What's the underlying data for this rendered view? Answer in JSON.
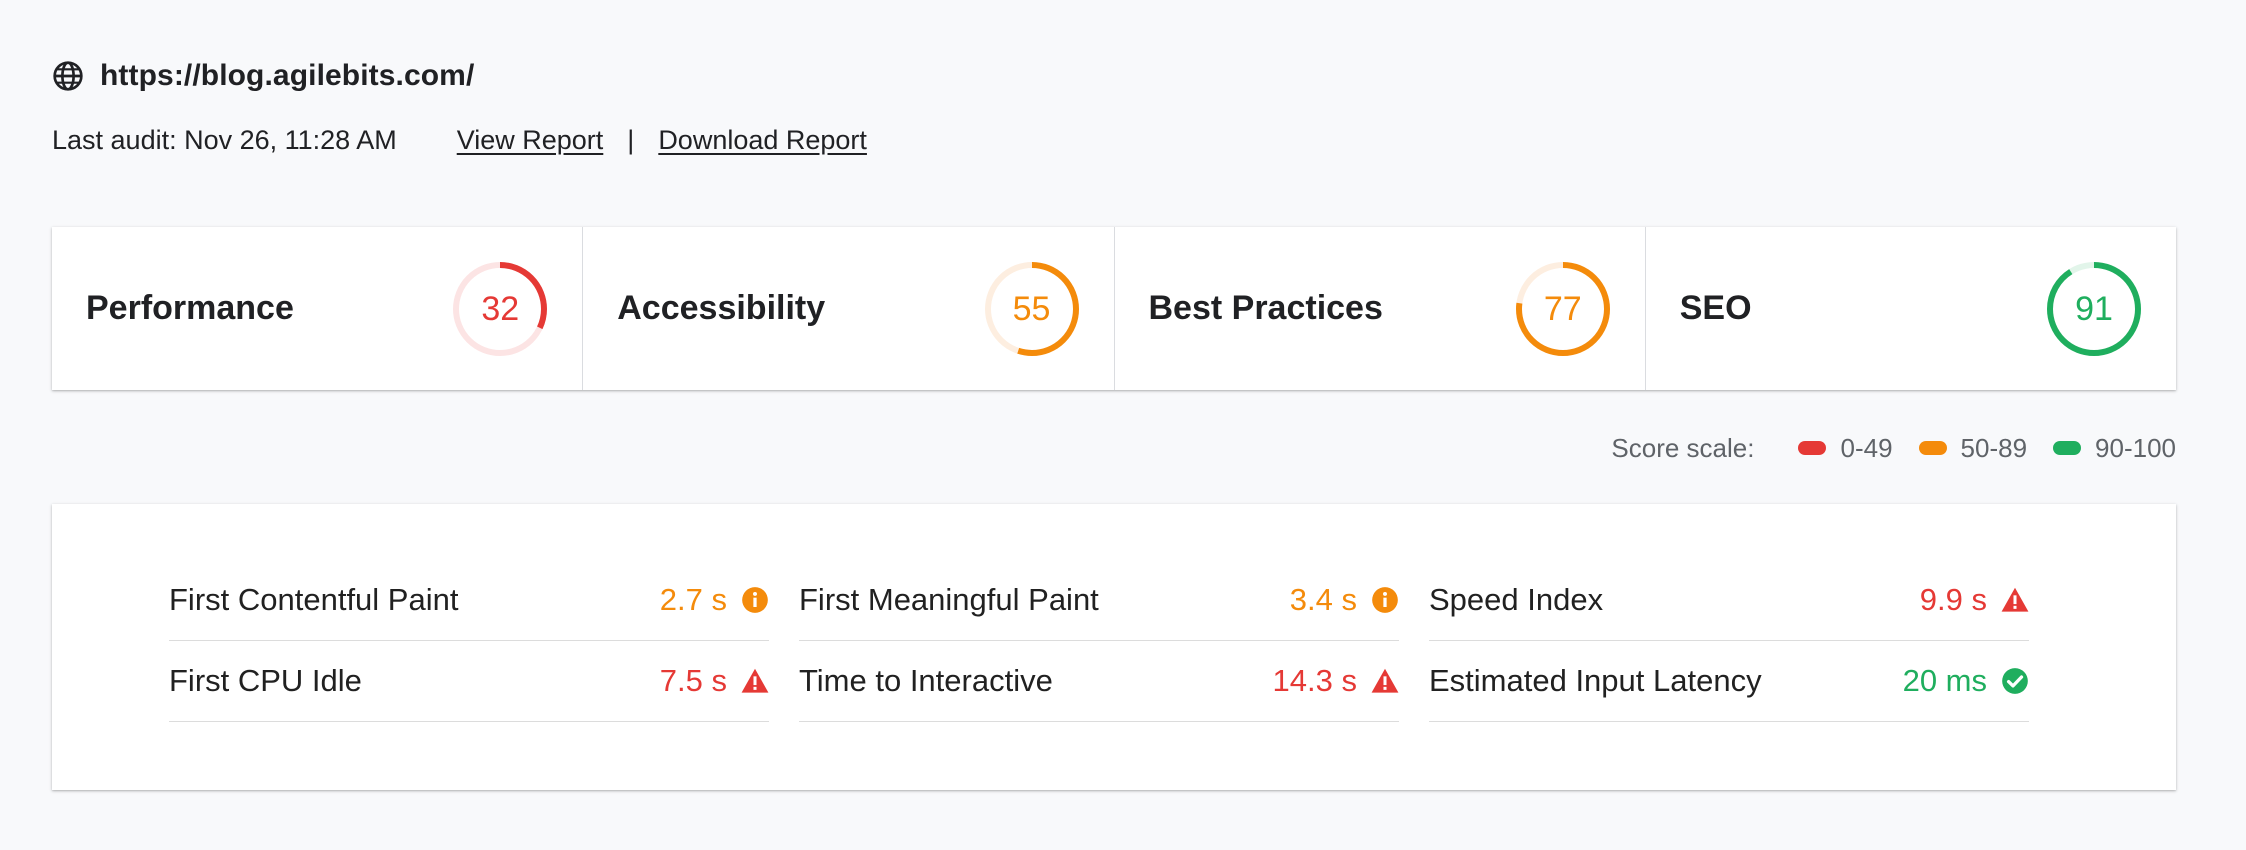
{
  "header": {
    "url": "https://blog.agilebits.com/",
    "last_audit": "Last audit: Nov 26, 11:28 AM",
    "view_report": "View Report",
    "separator": "|",
    "download_report": "Download Report"
  },
  "categories": [
    {
      "name": "Performance",
      "score": "32",
      "fraction": 0.32,
      "color": "#e53935",
      "track": "#fce4e4"
    },
    {
      "name": "Accessibility",
      "score": "55",
      "fraction": 0.55,
      "color": "#f48b0b",
      "track": "#fdeee0"
    },
    {
      "name": "Best Practices",
      "score": "77",
      "fraction": 0.77,
      "color": "#f48b0b",
      "track": "#fdeee0"
    },
    {
      "name": "SEO",
      "score": "91",
      "fraction": 0.91,
      "color": "#1fae5e",
      "track": "#e2f5ea"
    }
  ],
  "score_scale": {
    "label": "Score scale:",
    "ranges": [
      {
        "label": "0-49",
        "color": "#e53935"
      },
      {
        "label": "50-89",
        "color": "#f48b0b"
      },
      {
        "label": "90-100",
        "color": "#1fae5e"
      }
    ]
  },
  "metrics": [
    {
      "label": "First Contentful Paint",
      "value": "2.7 s",
      "status": "average",
      "icon": "info-icon"
    },
    {
      "label": "First Meaningful Paint",
      "value": "3.4 s",
      "status": "average",
      "icon": "info-icon"
    },
    {
      "label": "Speed Index",
      "value": "9.9 s",
      "status": "fail",
      "icon": "warning-icon"
    },
    {
      "label": "First CPU Idle",
      "value": "7.5 s",
      "status": "fail",
      "icon": "warning-icon"
    },
    {
      "label": "Time to Interactive",
      "value": "14.3 s",
      "status": "fail",
      "icon": "warning-icon"
    },
    {
      "label": "Estimated Input Latency",
      "value": "20 ms",
      "status": "pass",
      "icon": "check-circle-icon"
    }
  ],
  "status_colors": {
    "fail": "#e53935",
    "average": "#f48b0b",
    "pass": "#1fae5e"
  }
}
